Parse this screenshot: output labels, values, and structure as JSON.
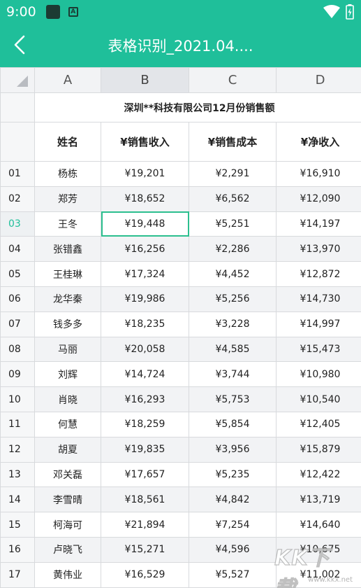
{
  "status_bar": {
    "time": "9:00",
    "icons": [
      "app-square-icon",
      "app-a-icon",
      "wifi-icon",
      "battery-charging-icon"
    ],
    "app_icon_letter": "A"
  },
  "app_bar": {
    "back_icon": "chevron-left-icon",
    "title": "表格识别_2021.04....",
    "color": "#1fbf9a"
  },
  "sheet": {
    "columns": [
      "A",
      "B",
      "C",
      "D"
    ],
    "selected_column": "B",
    "selected_row": "03",
    "title": "深圳**科技有限公司12月份销售额",
    "headers": [
      "姓名",
      "¥销售收入",
      "¥销售成本",
      "¥净收入"
    ],
    "rows": [
      {
        "num": "01",
        "name": "杨栋",
        "revenue": "¥19,201",
        "cost": "¥2,291",
        "net": "¥16,910"
      },
      {
        "num": "02",
        "name": "郑芳",
        "revenue": "¥18,652",
        "cost": "¥6,562",
        "net": "¥12,090"
      },
      {
        "num": "03",
        "name": "王冬",
        "revenue": "¥19,448",
        "cost": "¥5,251",
        "net": "¥14,197"
      },
      {
        "num": "04",
        "name": "张错鑫",
        "revenue": "¥16,256",
        "cost": "¥2,286",
        "net": "¥13,970"
      },
      {
        "num": "05",
        "name": "王桂琳",
        "revenue": "¥17,324",
        "cost": "¥4,452",
        "net": "¥12,872"
      },
      {
        "num": "06",
        "name": "龙华秦",
        "revenue": "¥19,986",
        "cost": "¥5,256",
        "net": "¥14,730"
      },
      {
        "num": "07",
        "name": "钱多多",
        "revenue": "¥18,235",
        "cost": "¥3,228",
        "net": "¥14,997"
      },
      {
        "num": "08",
        "name": "马丽",
        "revenue": "¥20,058",
        "cost": "¥4,585",
        "net": "¥15,473"
      },
      {
        "num": "09",
        "name": "刘辉",
        "revenue": "¥14,724",
        "cost": "¥3,744",
        "net": "¥10,980"
      },
      {
        "num": "10",
        "name": "肖晓",
        "revenue": "¥16,293",
        "cost": "¥5,753",
        "net": "¥10,540"
      },
      {
        "num": "11",
        "name": "何慧",
        "revenue": "¥18,259",
        "cost": "¥5,854",
        "net": "¥12,405"
      },
      {
        "num": "12",
        "name": "胡夏",
        "revenue": "¥19,835",
        "cost": "¥3,956",
        "net": "¥15,879"
      },
      {
        "num": "13",
        "name": "邓关磊",
        "revenue": "¥17,657",
        "cost": "¥5,235",
        "net": "¥12,422"
      },
      {
        "num": "14",
        "name": "李雪晴",
        "revenue": "¥18,561",
        "cost": "¥4,842",
        "net": "¥13,719"
      },
      {
        "num": "15",
        "name": "柯海可",
        "revenue": "¥21,894",
        "cost": "¥7,254",
        "net": "¥14,640"
      },
      {
        "num": "16",
        "name": "卢晓飞",
        "revenue": "¥15,271",
        "cost": "¥4,596",
        "net": "¥10,675"
      },
      {
        "num": "17",
        "name": "黄伟业",
        "revenue": "¥16,529",
        "cost": "¥5,527",
        "net": "¥11,002"
      }
    ]
  },
  "watermark": {
    "logo": "KK下载",
    "url": "www.kkx.net"
  }
}
